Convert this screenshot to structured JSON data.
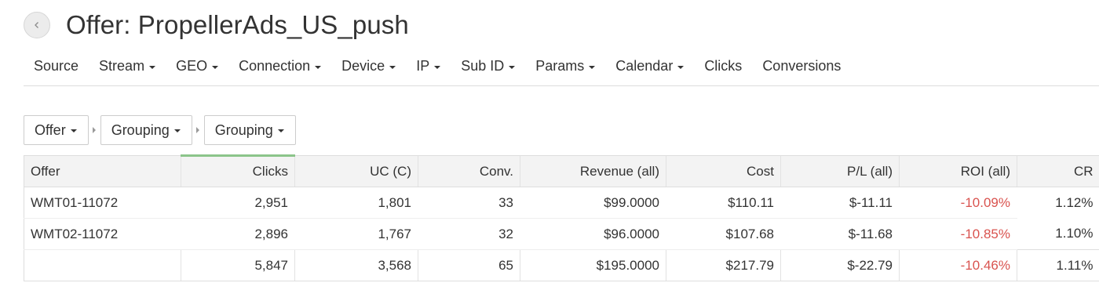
{
  "header": {
    "title": "Offer: PropellerAds_US_push"
  },
  "nav": {
    "items": [
      {
        "label": "Source",
        "dropdown": false
      },
      {
        "label": "Stream",
        "dropdown": true
      },
      {
        "label": "GEO",
        "dropdown": true
      },
      {
        "label": "Connection",
        "dropdown": true
      },
      {
        "label": "Device",
        "dropdown": true
      },
      {
        "label": "IP",
        "dropdown": true
      },
      {
        "label": "Sub ID",
        "dropdown": true
      },
      {
        "label": "Params",
        "dropdown": true
      },
      {
        "label": "Calendar",
        "dropdown": true
      },
      {
        "label": "Clicks",
        "dropdown": false
      },
      {
        "label": "Conversions",
        "dropdown": false
      }
    ]
  },
  "grouping": {
    "levels": [
      "Offer",
      "Grouping",
      "Grouping"
    ]
  },
  "table": {
    "columns": [
      "Offer",
      "Clicks",
      "UC (C)",
      "Conv.",
      "Revenue (all)",
      "Cost",
      "P/L (all)",
      "ROI (all)",
      "CR"
    ],
    "rows": [
      [
        "WMT01-11072",
        "2,951",
        "1,801",
        "33",
        "$99.0000",
        "$110.11",
        "$-11.11",
        "-10.09%",
        "1.12%"
      ],
      [
        "WMT02-11072",
        "2,896",
        "1,767",
        "32",
        "$96.0000",
        "$107.68",
        "$-11.68",
        "-10.85%",
        "1.10%"
      ]
    ],
    "total": [
      "",
      "5,847",
      "3,568",
      "65",
      "$195.0000",
      "$217.79",
      "$-22.79",
      "-10.46%",
      "1.11%"
    ]
  },
  "colors": {
    "negative": "#d9534f",
    "sorted_column_accent": "#8bc48a"
  }
}
